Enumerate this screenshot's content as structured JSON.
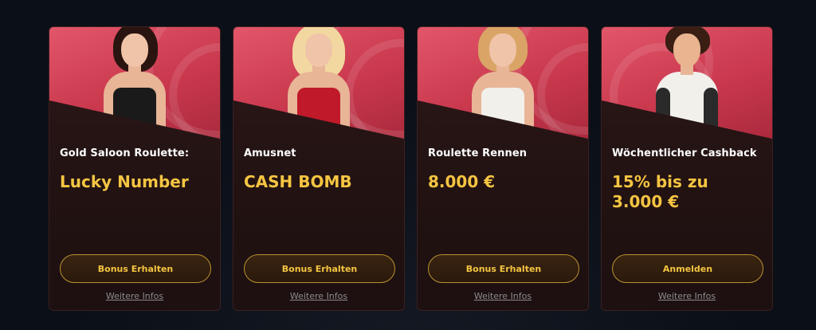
{
  "cards": [
    {
      "label": "Gold Saloon Roulette:",
      "headline": "Lucky Number",
      "button": "Bonus Erhalten",
      "more": "Weitere Infos",
      "hair_color": "#2a1410",
      "dress_color": "#1a1a1a"
    },
    {
      "label": "Amusnet",
      "headline": "CASH BOMB",
      "button": "Bonus Erhalten",
      "more": "Weitere Infos",
      "hair_color": "#f2d8a0",
      "dress_color": "#c01a2a"
    },
    {
      "label": "Roulette Rennen",
      "headline": "8.000 €",
      "button": "Bonus Erhalten",
      "more": "Weitere Infos",
      "hair_color": "#d9a466",
      "dress_color": "#f2f0ea"
    },
    {
      "label": "Wöchentlicher Cashback",
      "headline": "15% bis zu\n3.000 €",
      "button": "Anmelden",
      "more": "Weitere Infos",
      "hair_color": "#3a1e14",
      "dress_color": "#2a2a2a"
    }
  ],
  "colors": {
    "accent_gold": "#f5c542",
    "card_top_red": "#d9475c",
    "card_body_dark": "#241414",
    "page_background": "#0b0f17"
  }
}
